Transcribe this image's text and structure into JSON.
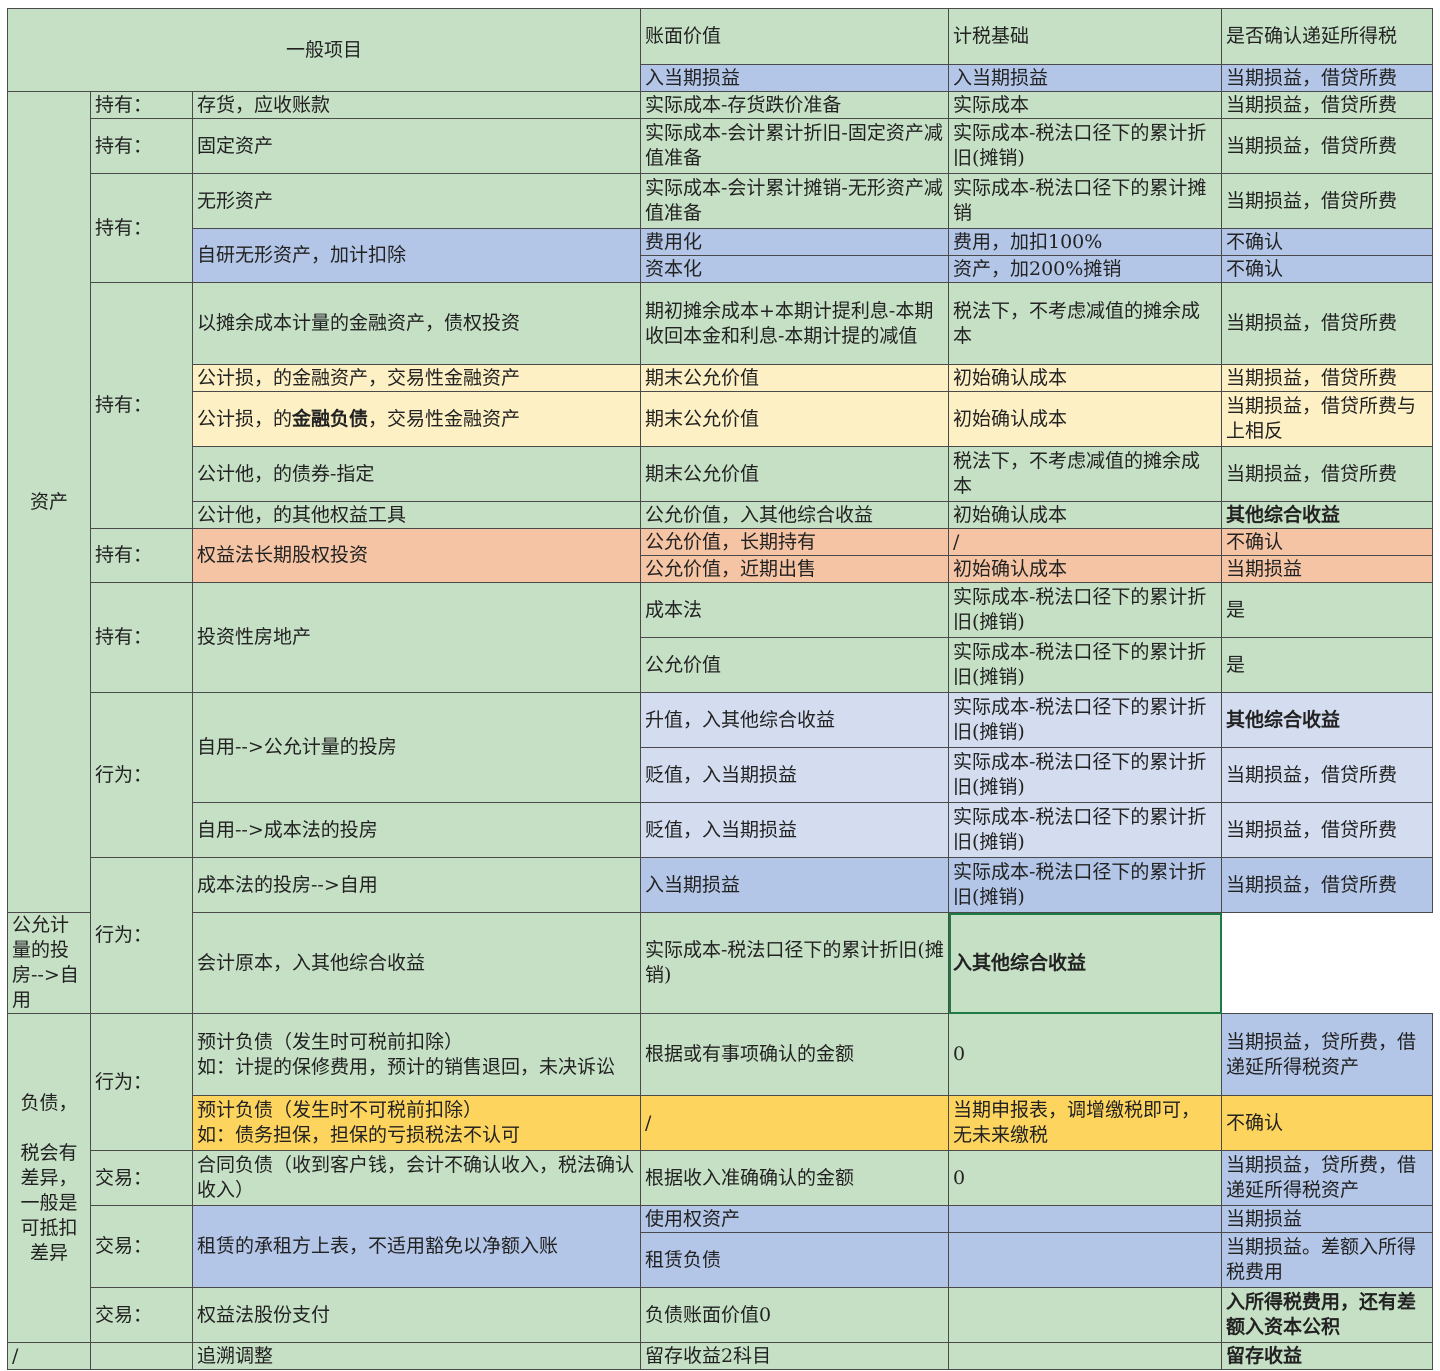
{
  "header": {
    "general_items": "一般项目",
    "book_value": "账面价值",
    "tax_basis": "计税基础",
    "deferred_tax": "是否确认递延所得税",
    "sub_book": "入当期损益",
    "sub_tax": "入当期损益",
    "sub_deferred": "当期损益，借贷所费"
  },
  "categories": {
    "assets": "资产",
    "liabilities": "负债，\n\n税会有差异，一般是可抵扣差异",
    "slash": "/"
  },
  "rows": [
    {
      "label": "持有：",
      "item": "存货，应收账款",
      "book": "实际成本-存货跌价准备",
      "tax": "实际成本",
      "deferred": "当期损益，借贷所费"
    },
    {
      "label": "持有：",
      "item": "固定资产",
      "book": "实际成本-会计累计折旧-固定资产减值准备",
      "tax": "实际成本-税法口径下的累计折旧(摊销)",
      "deferred": "当期损益，借贷所费"
    },
    {
      "label": "持有：",
      "item": "无形资产",
      "book": "实际成本-会计累计摊销-无形资产减值准备",
      "tax": "实际成本-税法口径下的累计摊销",
      "deferred": "当期损益，借贷所费"
    },
    {
      "item": "自研无形资产，加计扣除",
      "book": "费用化",
      "tax": "费用，加扣100%",
      "deferred": "不确认"
    },
    {
      "book": "资本化",
      "tax": "资产，加200%摊销",
      "deferred": "不确认"
    },
    {
      "label": "持有：",
      "item": "以摊余成本计量的金融资产，债权投资",
      "book": "期初摊余成本+本期计提利息-本期收回本金和利息-本期计提的减值",
      "tax": "税法下，不考虑减值的摊余成本",
      "deferred": "当期损益，借贷所费"
    },
    {
      "item": "公计损，的金融资产，交易性金融资产",
      "book": "期末公允价值",
      "tax": "初始确认成本",
      "deferred": "当期损益，借贷所费"
    },
    {
      "item_a": "公计损，的",
      "item_b": "金融负债",
      "item_c": "，交易性金融资产",
      "book": "期末公允价值",
      "tax": "初始确认成本",
      "deferred": "当期损益，借贷所费与上相反"
    },
    {
      "item": "公计他，的债券-指定",
      "book": "期末公允价值",
      "tax": "税法下，不考虑减值的摊余成本",
      "deferred": "当期损益，借贷所费"
    },
    {
      "item": "公计他，的其他权益工具",
      "book": "公允价值，入其他综合收益",
      "tax": "初始确认成本",
      "deferred": "其他综合收益"
    },
    {
      "label": "持有：",
      "item": "权益法长期股权投资",
      "book": "公允价值，长期持有",
      "tax": "/",
      "deferred": "不确认"
    },
    {
      "book": "公允价值，近期出售",
      "tax": "初始确认成本",
      "deferred": "当期损益"
    },
    {
      "label": "持有：",
      "item": "投资性房地产",
      "book": "成本法",
      "tax": "实际成本-税法口径下的累计折旧(摊销)",
      "deferred": "是"
    },
    {
      "book": "公允价值",
      "tax": "实际成本-税法口径下的累计折旧(摊销)",
      "deferred": "是"
    },
    {
      "label": "行为：",
      "item": "自用-->公允计量的投房",
      "book": "升值，入其他综合收益",
      "tax": "实际成本-税法口径下的累计折旧(摊销)",
      "deferred": "其他综合收益"
    },
    {
      "book": "贬值，入当期损益",
      "tax": "实际成本-税法口径下的累计折旧(摊销)",
      "deferred": "当期损益，借贷所费"
    },
    {
      "item": "自用-->成本法的投房",
      "book": "贬值，入当期损益",
      "tax": "实际成本-税法口径下的累计折旧(摊销)",
      "deferred": "当期损益，借贷所费"
    },
    {
      "label": "行为：",
      "item": "成本法的投房-->自用",
      "book": "入当期损益",
      "tax": "实际成本-税法口径下的累计折旧(摊销)",
      "deferred": "当期损益，借贷所费"
    },
    {
      "item": "公允计量的投房-->自用",
      "book": "会计原本，入其他综合收益",
      "tax": "实际成本-税法口径下的累计折旧(摊销)",
      "deferred": "入其他综合收益"
    },
    {
      "label": "行为：",
      "item": "预计负债（发生时可税前扣除）\n如：计提的保修费用，预计的销售退回，未决诉讼",
      "book": "根据或有事项确认的金额",
      "tax": "0",
      "deferred": "当期损益，贷所费，借递延所得税资产"
    },
    {
      "item": "预计负债（发生时不可税前扣除）\n如：债务担保，担保的亏损税法不认可",
      "book": "/",
      "tax": "当期申报表，调增缴税即可，无未来缴税",
      "deferred": "不确认"
    },
    {
      "label": "交易：",
      "item": "合同负债（收到客户钱，会计不确认收入，税法确认收入）",
      "book": "根据收入准确确认的金额",
      "tax": "0",
      "deferred": "当期损益，贷所费，借递延所得税资产"
    },
    {
      "label": "交易：",
      "item": "租赁的承租方上表，不适用豁免以净额入账",
      "book": "使用权资产",
      "tax": "",
      "deferred": "当期损益"
    },
    {
      "book": "租赁负债",
      "tax": "",
      "deferred": "当期损益。差额入所得税费用"
    },
    {
      "label": "交易：",
      "item": "权益法股份支付",
      "book": "负债账面价值0",
      "tax": "",
      "deferred": "入所得税费用，还有差额入资本公积"
    },
    {
      "label": "",
      "item": "追溯调整",
      "book": "留存收益2科目",
      "tax": "",
      "deferred": "留存收益"
    }
  ]
}
